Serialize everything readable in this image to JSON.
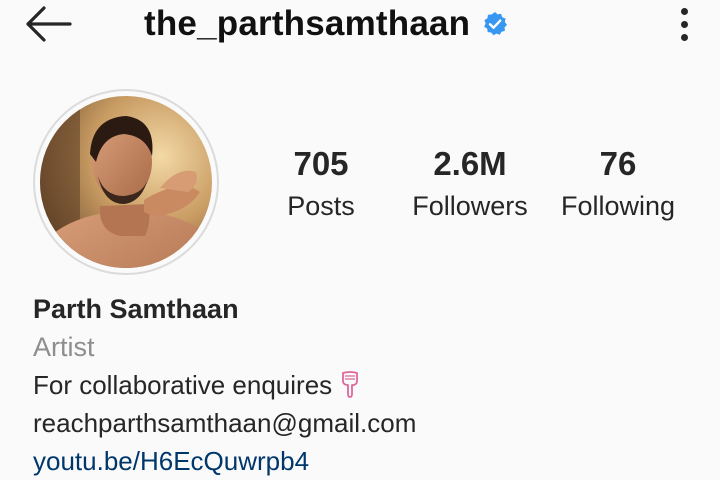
{
  "header": {
    "username": "the_parthsamthaan",
    "back_icon": "arrow-left-icon",
    "verified_icon": "verified-badge-icon",
    "menu_icon": "more-vertical-icon",
    "verified_color": "#3897f0"
  },
  "stats": {
    "posts": {
      "value": "705",
      "label": "Posts"
    },
    "followers": {
      "value": "2.6M",
      "label": "Followers"
    },
    "following": {
      "value": "76",
      "label": "Following"
    }
  },
  "bio": {
    "name": "Parth Samthaan",
    "category": "Artist",
    "line1": "For collaborative enquires",
    "line1_emoji": "pointing-down-icon",
    "email": "reachparthsamthaan@gmail.com",
    "link": "youtu.be/H6EcQuwrpb4",
    "link_color": "#00376b",
    "category_color": "#8e8e8e"
  }
}
